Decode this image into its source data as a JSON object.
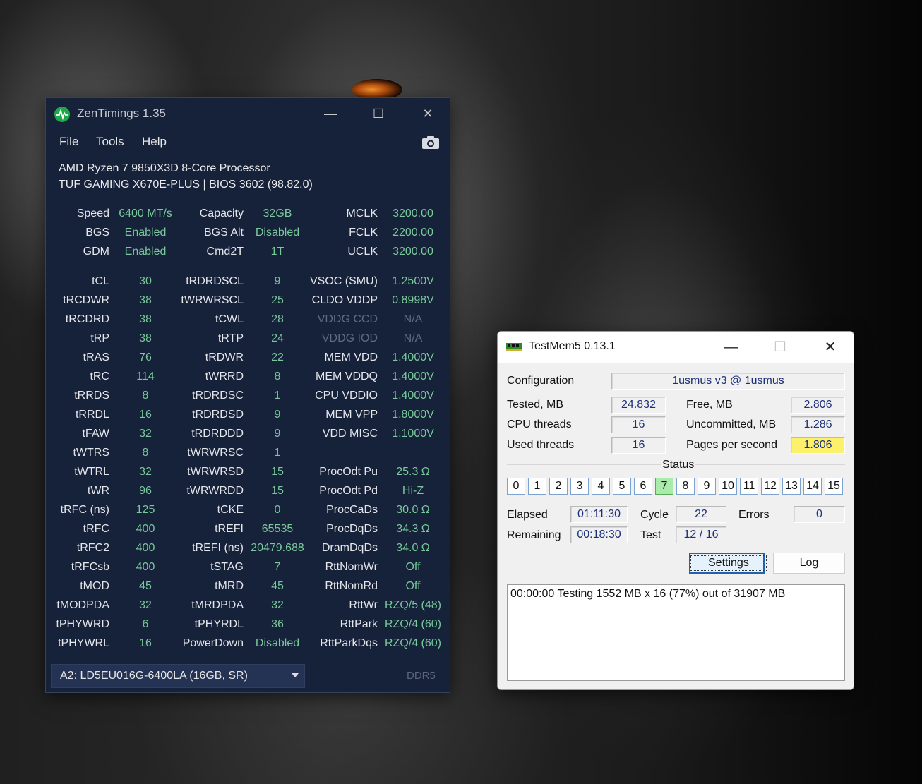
{
  "zentimings": {
    "title": "ZenTimings 1.35",
    "menu": [
      "File",
      "Tools",
      "Help"
    ],
    "cpu": "AMD Ryzen 7 9850X3D 8-Core Processor",
    "board": "TUF GAMING X670E-PLUS | BIOS 3602 (98.82.0)",
    "top": [
      [
        {
          "l": "Speed",
          "v": "6400 MT/s"
        },
        {
          "l": "Capacity",
          "v": "32GB"
        },
        {
          "l": "MCLK",
          "v": "3200.00"
        }
      ],
      [
        {
          "l": "BGS",
          "v": "Enabled"
        },
        {
          "l": "BGS Alt",
          "v": "Disabled"
        },
        {
          "l": "FCLK",
          "v": "2200.00"
        }
      ],
      [
        {
          "l": "GDM",
          "v": "Enabled"
        },
        {
          "l": "Cmd2T",
          "v": "1T"
        },
        {
          "l": "UCLK",
          "v": "3200.00"
        }
      ]
    ],
    "timings": [
      [
        {
          "l": "tCL",
          "v": "30"
        },
        {
          "l": "tRDRDSCL",
          "v": "9"
        },
        {
          "l": "VSOC (SMU)",
          "v": "1.2500V"
        }
      ],
      [
        {
          "l": "tRCDWR",
          "v": "38"
        },
        {
          "l": "tWRWRSCL",
          "v": "25"
        },
        {
          "l": "CLDO VDDP",
          "v": "0.8998V"
        }
      ],
      [
        {
          "l": "tRCDRD",
          "v": "38"
        },
        {
          "l": "tCWL",
          "v": "28"
        },
        {
          "l": "VDDG CCD",
          "v": "N/A",
          "dim": true
        }
      ],
      [
        {
          "l": "tRP",
          "v": "38"
        },
        {
          "l": "tRTP",
          "v": "24"
        },
        {
          "l": "VDDG IOD",
          "v": "N/A",
          "dim": true
        }
      ],
      [
        {
          "l": "tRAS",
          "v": "76"
        },
        {
          "l": "tRDWR",
          "v": "22"
        },
        {
          "l": "MEM VDD",
          "v": "1.4000V"
        }
      ],
      [
        {
          "l": "tRC",
          "v": "114"
        },
        {
          "l": "tWRRD",
          "v": "8"
        },
        {
          "l": "MEM VDDQ",
          "v": "1.4000V"
        }
      ],
      [
        {
          "l": "tRRDS",
          "v": "8"
        },
        {
          "l": "tRDRDSC",
          "v": "1"
        },
        {
          "l": "CPU VDDIO",
          "v": "1.4000V"
        }
      ],
      [
        {
          "l": "tRRDL",
          "v": "16"
        },
        {
          "l": "tRDRDSD",
          "v": "9"
        },
        {
          "l": "MEM VPP",
          "v": "1.8000V"
        }
      ],
      [
        {
          "l": "tFAW",
          "v": "32"
        },
        {
          "l": "tRDRDDD",
          "v": "9"
        },
        {
          "l": "VDD MISC",
          "v": "1.1000V"
        }
      ],
      [
        {
          "l": "tWTRS",
          "v": "8"
        },
        {
          "l": "tWRWRSC",
          "v": "1"
        },
        {
          "l": "",
          "v": ""
        }
      ],
      [
        {
          "l": "tWTRL",
          "v": "32"
        },
        {
          "l": "tWRWRSD",
          "v": "15"
        },
        {
          "l": "ProcOdt Pu",
          "v": "25.3 Ω"
        }
      ],
      [
        {
          "l": "tWR",
          "v": "96"
        },
        {
          "l": "tWRWRDD",
          "v": "15"
        },
        {
          "l": "ProcOdt Pd",
          "v": "Hi-Z"
        }
      ],
      [
        {
          "l": "tRFC (ns)",
          "v": "125"
        },
        {
          "l": "tCKE",
          "v": "0"
        },
        {
          "l": "ProcCaDs",
          "v": "30.0 Ω"
        }
      ],
      [
        {
          "l": "tRFC",
          "v": "400"
        },
        {
          "l": "tREFI",
          "v": "65535"
        },
        {
          "l": "ProcDqDs",
          "v": "34.3 Ω"
        }
      ],
      [
        {
          "l": "tRFC2",
          "v": "400"
        },
        {
          "l": "tREFI (ns)",
          "v": "20479.688"
        },
        {
          "l": "DramDqDs",
          "v": "34.0 Ω"
        }
      ],
      [
        {
          "l": "tRFCsb",
          "v": "400"
        },
        {
          "l": "tSTAG",
          "v": "7"
        },
        {
          "l": "RttNomWr",
          "v": "Off"
        }
      ],
      [
        {
          "l": "tMOD",
          "v": "45"
        },
        {
          "l": "tMRD",
          "v": "45"
        },
        {
          "l": "RttNomRd",
          "v": "Off"
        }
      ],
      [
        {
          "l": "tMODPDA",
          "v": "32"
        },
        {
          "l": "tMRDPDA",
          "v": "32"
        },
        {
          "l": "RttWr",
          "v": "RZQ/5 (48)"
        }
      ],
      [
        {
          "l": "tPHYWRD",
          "v": "6"
        },
        {
          "l": "tPHYRDL",
          "v": "36"
        },
        {
          "l": "RttPark",
          "v": "RZQ/4 (60)"
        }
      ],
      [
        {
          "l": "tPHYWRL",
          "v": "16"
        },
        {
          "l": "PowerDown",
          "v": "Disabled"
        },
        {
          "l": "RttParkDqs",
          "v": "RZQ/4 (60)"
        }
      ]
    ],
    "dimm_selected": "A2: LD5EU016G-6400LA (16GB, SR)",
    "mem_type": "DDR5"
  },
  "testmem": {
    "title": "TestMem5  0.13.1",
    "config_label": "Configuration",
    "config_value": "1usmus v3 @ 1usmus",
    "tested_label": "Tested, MB",
    "tested_value": "24.832",
    "free_label": "Free, MB",
    "free_value": "2.806",
    "cpu_threads_label": "CPU threads",
    "cpu_threads_value": "16",
    "uncommitted_label": "Uncommitted, MB",
    "uncommitted_value": "1.286",
    "used_threads_label": "Used threads",
    "used_threads_value": "16",
    "pps_label": "Pages per second",
    "pps_value": "1.806",
    "status_label": "Status",
    "threads": [
      "0",
      "1",
      "2",
      "3",
      "4",
      "5",
      "6",
      "7",
      "8",
      "9",
      "10",
      "11",
      "12",
      "13",
      "14",
      "15"
    ],
    "active_thread": 7,
    "elapsed_label": "Elapsed",
    "elapsed_value": "01:11:30",
    "cycle_label": "Cycle",
    "cycle_value": "22",
    "errors_label": "Errors",
    "errors_value": "0",
    "remaining_label": "Remaining",
    "remaining_value": "00:18:30",
    "test_label": "Test",
    "test_value": "12 / 16",
    "settings_label": "Settings",
    "log_label": "Log",
    "log_text": "00:00:00  Testing 1552 MB x 16 (77%) out of 31907 MB",
    "highlight_color": "#fdf06a"
  }
}
